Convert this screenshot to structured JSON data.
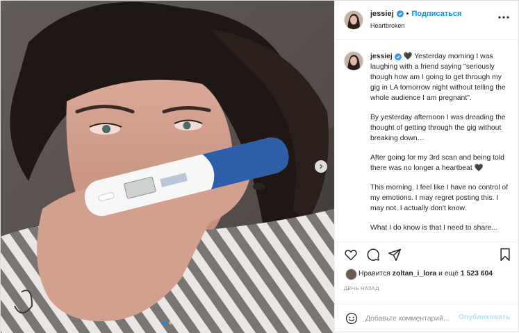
{
  "post": {
    "username": "jessiej",
    "follow_label": "Подписаться",
    "separator": "•",
    "location": "Heartbroken",
    "caption_username": "jessiej",
    "caption_paragraphs": [
      "🖤 Yesterday morning I was laughing with a friend saying \"seriously though how am I going to get through my gig in LA tomorrow night without telling the whole audience I am pregnant\".",
      "By yesterday afternoon I was dreading the thought of getting through the gig without breaking down…",
      "After going for my 3rd scan and being told there was no longer a heartbeat 🖤",
      "This morning. I feel like I have no control of my emotions. I may regret posting this. I may not. I actually don't know.",
      "What I do know is that I need to share..."
    ],
    "likes_prefix": "Нравится ",
    "likes_user": "zoltan_i_lora",
    "likes_middle": " и ещё ",
    "likes_count": "1 523 604",
    "time_ago": "День назад",
    "comment_placeholder": "Добавьте комментарий...",
    "publish_label": "Опубликовать",
    "carousel_total": 2,
    "carousel_active": 1
  },
  "icons": {
    "verified": "verified-badge-icon",
    "more": "more-options-icon",
    "like": "heart-icon",
    "comment": "comment-icon",
    "share": "paper-plane-icon",
    "save": "bookmark-icon",
    "emoji": "emoji-icon",
    "next": "chevron-right-icon"
  },
  "colors": {
    "accent": "#0095f6",
    "verified": "#3897f0",
    "publish_disabled": "#b2dffc",
    "muted": "#8e8e8e"
  }
}
